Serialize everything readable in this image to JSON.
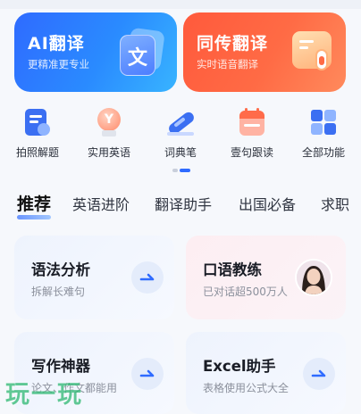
{
  "banner_cards": [
    {
      "title": "AI翻译",
      "subtitle": "更精准更专业",
      "icon_text": "文",
      "icon": "document-translate-icon"
    },
    {
      "title": "同传翻译",
      "subtitle": "实时语音翻译",
      "icon": "microphone-card-icon"
    }
  ],
  "tools": [
    {
      "label": "拍照解题",
      "icon": "photo-solve-icon"
    },
    {
      "label": "实用英语",
      "icon": "bulb-y-icon"
    },
    {
      "label": "词典笔",
      "icon": "dictionary-pen-icon"
    },
    {
      "label": "壹句跟读",
      "icon": "calendar-read-icon"
    },
    {
      "label": "全部功能",
      "icon": "all-grid-icon"
    }
  ],
  "tabs": [
    "推荐",
    "英语进阶",
    "翻译助手",
    "出国必备",
    "求职"
  ],
  "feature_cards": [
    {
      "title": "语法分析",
      "subtitle": "拆解长难句",
      "icon": "arrow-right-icon"
    },
    {
      "title": "口语教练",
      "subtitle": "已对话超500万人",
      "icon": "avatar"
    },
    {
      "title": "写作神器",
      "subtitle": "论文、作文都能用",
      "icon": "arrow-right-icon"
    },
    {
      "title": "Excel助手",
      "subtitle": "表格使用公式大全",
      "icon": "arrow-right-icon"
    }
  ],
  "watermark": "玩一玩",
  "colors": {
    "accent_blue": "#2f6bff",
    "accent_orange": "#ff5a3c",
    "watermark_green": "#2eb872"
  }
}
